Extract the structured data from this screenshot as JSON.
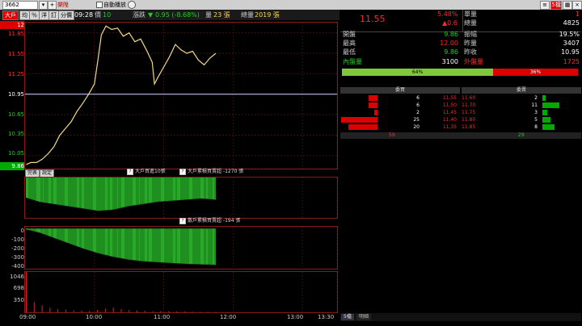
{
  "toolbar": {
    "stock_code": "3662",
    "name": "樂陞",
    "auto_play_label": "自動播放",
    "right_btn_label": "5檔"
  },
  "tabs": [
    {
      "label": "大戶"
    },
    {
      "label": "均"
    },
    {
      "label": "％"
    },
    {
      "label": "洋"
    },
    {
      "label": "訂"
    },
    {
      "label": "分價"
    }
  ],
  "info": {
    "time": "09:28",
    "price_label": "價",
    "price": "10",
    "change_label": "漲跌",
    "change": "0.95 (-8.68%)",
    "volume_label": "量",
    "volume": "23 張",
    "total_label": "總量",
    "total": "2019 張"
  },
  "price_axis": {
    "ticks": [
      "12",
      "11.85",
      "11.55",
      "11.25",
      "10.95",
      "10.65",
      "10.35",
      "10.05",
      "9.86"
    ]
  },
  "indicator": {
    "tab1": "完表",
    "tab2": "說定",
    "legend1_icon": "?",
    "legend1": "大戶買進10張",
    "legend2_icon": "?",
    "legend2": "大戶累積買賣超 -1270 張",
    "legend3_icon": "?",
    "legend3": "散戶累積買賣超 -194 張",
    "ticks": [
      "0",
      "-100",
      "-200",
      "-300",
      "-400"
    ]
  },
  "volume_axis": {
    "ticks": [
      "1046",
      "698",
      "350"
    ]
  },
  "time_axis": [
    "09:00",
    "10:00",
    "11:00",
    "12:00",
    "13:00",
    "13:30"
  ],
  "chart_data": {
    "type": "line",
    "title": "",
    "x_range": [
      "09:00",
      "13:30"
    ],
    "ylim": [
      9.86,
      12.0
    ],
    "x": [
      "09:01",
      "09:05",
      "09:10",
      "09:15",
      "09:20",
      "09:25",
      "09:30",
      "09:35",
      "09:40",
      "09:45",
      "09:50",
      "09:55",
      "10:00",
      "10:03",
      "10:06",
      "10:10",
      "10:15",
      "10:20",
      "10:25",
      "10:30",
      "10:35",
      "10:40",
      "10:45",
      "10:50",
      "10:52",
      "10:55",
      "11:00",
      "11:05",
      "11:10",
      "11:15",
      "11:20",
      "11:25",
      "11:30",
      "11:35",
      "11:40",
      "11:45"
    ],
    "series": [
      {
        "values": [
          9.92,
          9.95,
          9.95,
          10.0,
          10.08,
          10.18,
          10.35,
          10.45,
          10.55,
          10.7,
          10.82,
          10.95,
          11.1,
          11.45,
          11.82,
          11.95,
          11.9,
          11.92,
          11.8,
          11.85,
          11.72,
          11.76,
          11.6,
          11.42,
          11.1,
          11.2,
          11.35,
          11.5,
          11.68,
          11.6,
          11.55,
          11.58,
          11.45,
          11.38,
          11.48,
          11.55
        ]
      }
    ],
    "indicator_series": [
      {
        "values": [
          -90,
          -110,
          -120,
          -130,
          -140,
          -150,
          -145,
          -130,
          -120,
          -110,
          -105,
          -100,
          -95,
          -100
        ]
      },
      {
        "values": [
          -10,
          -50,
          -110,
          -170,
          -230,
          -280,
          -320,
          -350,
          -370,
          -380,
          -390,
          -400,
          -405,
          -410
        ]
      }
    ],
    "volume_ylim": [
      0,
      1046
    ],
    "volume_values": [
      1046,
      260,
      180,
      120,
      80,
      70,
      50,
      40,
      35,
      60,
      90,
      120,
      80,
      60,
      50,
      40,
      30,
      30,
      25,
      20,
      25,
      20,
      18,
      15,
      12
    ]
  },
  "quote": {
    "price": "11.55",
    "pct": "5.48%",
    "chg": "▲0.6",
    "unit_label": "單量",
    "unit": "1",
    "total_label": "總量",
    "total": "4825",
    "rows": [
      {
        "l": "開盤",
        "lv": "9.86",
        "r": "振幅",
        "rv": "19.5%"
      },
      {
        "l": "最高",
        "lv": "12.00",
        "r": "昨量",
        "rv": "3407"
      },
      {
        "l": "最低",
        "lv": "9.86",
        "r": "昨收",
        "rv": "10.95"
      }
    ],
    "inner_label": "內盤量",
    "inner": "3100",
    "outer_label": "外盤量",
    "outer": "1725",
    "inner_pct": "64%",
    "outer_pct": "36%",
    "inner_share": 0.64
  },
  "orderbook": {
    "buy_header": "委買",
    "sell_header": "委賣",
    "rows": [
      {
        "bq": "6",
        "bp": "11.55",
        "ap": "11.60",
        "aq": "2"
      },
      {
        "bq": "6",
        "bp": "11.50",
        "ap": "11.70",
        "aq": "11"
      },
      {
        "bq": "2",
        "bp": "11.45",
        "ap": "11.75",
        "aq": "3"
      },
      {
        "bq": "25",
        "bp": "11.40",
        "ap": "11.80",
        "aq": "5"
      },
      {
        "bq": "20",
        "bp": "11.35",
        "ap": "11.85",
        "aq": "8"
      }
    ],
    "buy_total": "59",
    "sell_total": "29"
  },
  "bottom_tabs": [
    {
      "label": "5檔"
    },
    {
      "label": "明細"
    }
  ],
  "colors": {
    "up": "#ff2a2a",
    "down": "#22cc22",
    "line": "#f0d98a",
    "bar_green": "#1f8f1f"
  }
}
